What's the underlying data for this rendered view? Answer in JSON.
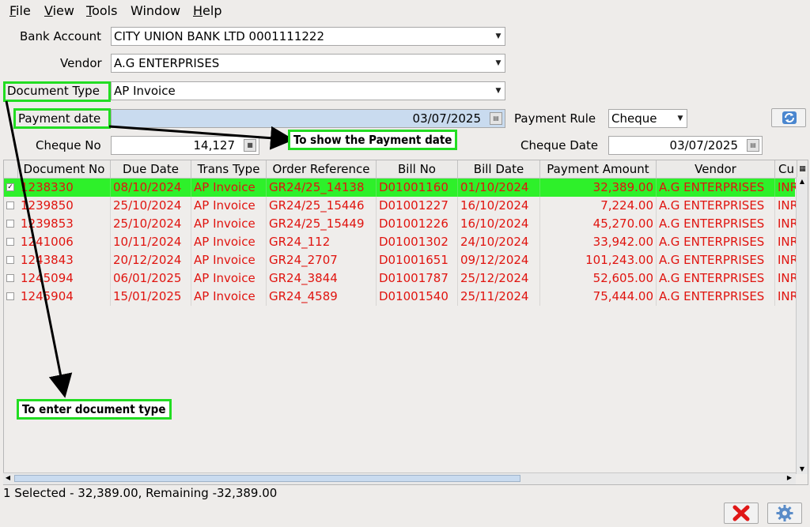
{
  "menu": [
    {
      "underline": "F",
      "rest": "ile"
    },
    {
      "underline": "V",
      "rest": "iew"
    },
    {
      "underline": "T",
      "rest": "ools"
    },
    {
      "underline": "W",
      "rest": "indow",
      "no_underline": true
    },
    {
      "underline": "H",
      "rest": "elp"
    }
  ],
  "form": {
    "bank_account_label": "Bank Account",
    "bank_account_value": "CITY UNION BANK LTD 0001111222",
    "vendor_label": "Vendor",
    "vendor_value": "A.G ENTERPRISES",
    "document_type_label": "Document Type",
    "document_type_value": "AP Invoice",
    "payment_date_label": "Payment date",
    "payment_date_value": "03/07/2025",
    "payment_rule_label": "Payment Rule",
    "payment_rule_value": "Cheque",
    "cheque_no_label": "Cheque No",
    "cheque_no_value": "14,127",
    "cheque_date_label": "Cheque Date",
    "cheque_date_value": "03/07/2025"
  },
  "annotations": {
    "payment_date_note": "To show the Payment date",
    "document_type_note": "To enter document type"
  },
  "table": {
    "headers": [
      "Document No",
      "Due Date",
      "Trans Type",
      "Order Reference",
      "Bill No",
      "Bill Date",
      "Payment Amount",
      "Vendor",
      "Cu"
    ],
    "rows": [
      {
        "selected": true,
        "cells": [
          "1238330",
          "08/10/2024",
          "AP Invoice",
          "GR24/25_14138",
          "D01001160",
          "01/10/2024",
          "32,389.00",
          "A.G ENTERPRISES",
          "INR"
        ]
      },
      {
        "selected": false,
        "cells": [
          "1239850",
          "25/10/2024",
          "AP Invoice",
          "GR24/25_15446",
          "D01001227",
          "16/10/2024",
          "7,224.00",
          "A.G ENTERPRISES",
          "INR"
        ]
      },
      {
        "selected": false,
        "cells": [
          "1239853",
          "25/10/2024",
          "AP Invoice",
          "GR24/25_15449",
          "D01001226",
          "16/10/2024",
          "45,270.00",
          "A.G ENTERPRISES",
          "INR"
        ]
      },
      {
        "selected": false,
        "cells": [
          "1241006",
          "10/11/2024",
          "AP Invoice",
          "GR24_112",
          "D01001302",
          "24/10/2024",
          "33,942.00",
          "A.G ENTERPRISES",
          "INR"
        ]
      },
      {
        "selected": false,
        "cells": [
          "1243843",
          "20/12/2024",
          "AP Invoice",
          "GR24_2707",
          "D01001651",
          "09/12/2024",
          "101,243.00",
          "A.G ENTERPRISES",
          "INR"
        ]
      },
      {
        "selected": false,
        "cells": [
          "1245094",
          "06/01/2025",
          "AP Invoice",
          "GR24_3844",
          "D01001787",
          "25/12/2024",
          "52,605.00",
          "A.G ENTERPRISES",
          "INR"
        ]
      },
      {
        "selected": false,
        "cells": [
          "1245904",
          "15/01/2025",
          "AP Invoice",
          "GR24_4589",
          "D01001540",
          "25/11/2024",
          "75,444.00",
          "A.G ENTERPRISES",
          "INR"
        ]
      }
    ]
  },
  "status_text": "1 Selected - 32,389.00, Remaining -32,389.00",
  "icons": {
    "refresh": "refresh-icon",
    "cancel": "cancel-x-icon",
    "ok": "gear-icon"
  },
  "colors": {
    "selected_row": "#2ef02a",
    "row_text": "#e0140f",
    "annotation_border": "#22dd22"
  }
}
